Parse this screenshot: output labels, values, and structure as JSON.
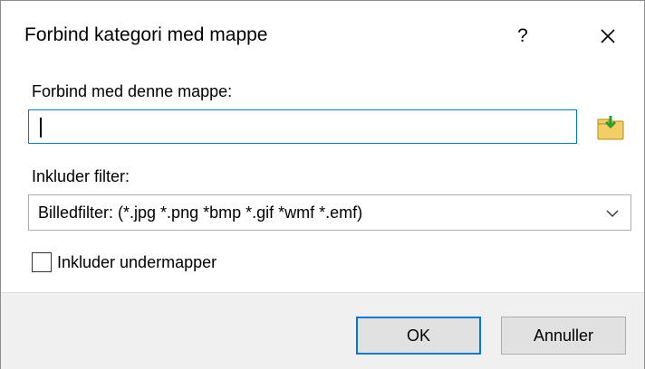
{
  "dialog": {
    "title": "Forbind kategori med mappe",
    "help_label": "?",
    "close_icon": "close-icon"
  },
  "folder": {
    "label": "Forbind med denne mappe:",
    "value": "",
    "browse_icon": "folder-browse-icon"
  },
  "filter": {
    "label": "Inkluder filter:",
    "selected": "Billedfilter: (*.jpg *.png *bmp *.gif *wmf *.emf)"
  },
  "subfolders": {
    "label": "Inkluder undermapper",
    "checked": false
  },
  "buttons": {
    "ok": "OK",
    "cancel": "Annuller"
  },
  "colors": {
    "accent": "#0078d7",
    "footer_bg": "#f0f0f0",
    "button_bg": "#e1e1e1"
  }
}
